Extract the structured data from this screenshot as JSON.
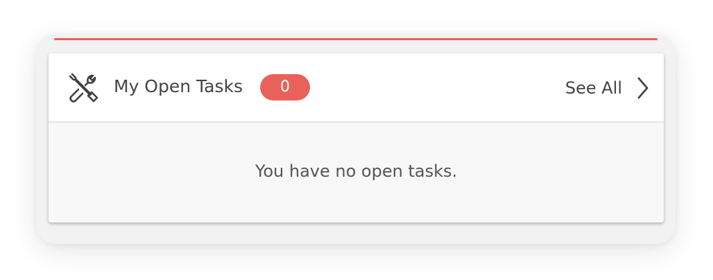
{
  "widget": {
    "title": "My Open Tasks",
    "icon": "tools-icon",
    "count": "0",
    "see_all_label": "See All",
    "see_all_icon": "chevron-right-icon",
    "empty_message": "You have no open tasks."
  },
  "colors": {
    "accent": "#e8625b",
    "text": "#444444",
    "card_background": "#f8f8f8",
    "header_background": "#ffffff"
  }
}
